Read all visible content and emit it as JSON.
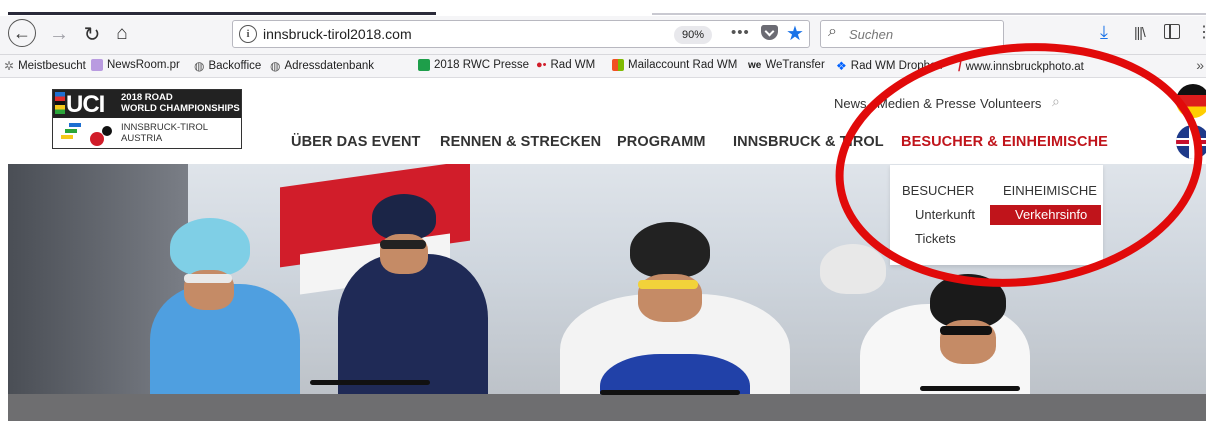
{
  "browser": {
    "url": "innsbruck-tirol2018.com",
    "zoom": "90%",
    "more_glyph": "•••",
    "search_placeholder": "Suchen",
    "bookmarks": [
      {
        "label": "Meistbesucht",
        "icon": "gear-star-icon",
        "color": "#777777"
      },
      {
        "label": "NewsRoom.pr",
        "icon": "newsroom-icon",
        "color": "#7d4cc7"
      },
      {
        "label": "Backoffice",
        "icon": "globe-icon",
        "color": "#555555"
      },
      {
        "label": "Adressdatenbank",
        "icon": "globe-icon",
        "color": "#555555"
      },
      {
        "label": "2018 RWC Presse",
        "icon": "sheet-icon",
        "color": "#1e9e4a"
      },
      {
        "label": "Rad WM",
        "icon": "bike-icon",
        "color": "#d11d2a"
      },
      {
        "label": "Mailaccount Rad WM",
        "icon": "windows-icon",
        "color": "#f25022"
      },
      {
        "label": "WeTransfer",
        "icon": "wetransfer-icon",
        "color": "#111111"
      },
      {
        "label": "Rad WM Dropbox",
        "icon": "dropbox-icon",
        "color": "#0061fe"
      },
      {
        "label": "www.innsbruckphoto.at",
        "icon": "slash-icon",
        "color": "#d11d2a"
      }
    ],
    "bookmarks_overflow": "»"
  },
  "logo": {
    "letters": "UCI",
    "line1": "2018 ROAD",
    "line2": "WORLD CHAMPIONSHIPS",
    "city1": "INNSBRUCK-TIROL",
    "city2": "AUSTRIA"
  },
  "topnav": {
    "news": "News",
    "media": "Medien & Presse",
    "volunteers": "Volunteers"
  },
  "mainnav": [
    {
      "label": "ÜBER DAS EVENT",
      "active": false
    },
    {
      "label": "RENNEN & STRECKEN",
      "active": false
    },
    {
      "label": "PROGRAMM",
      "active": false
    },
    {
      "label": "INNSBRUCK & TIROL",
      "active": false
    },
    {
      "label": "BESUCHER & EINHEIMISCHE",
      "active": true
    }
  ],
  "dropdown": {
    "col1_head": "BESUCHER",
    "col1_items": [
      "Unterkunft",
      "Tickets"
    ],
    "col2_head": "EINHEIMISCHE",
    "col2_items": [
      "Verkehrsinfo"
    ]
  },
  "colors": {
    "brand_red": "#c0141b",
    "annotation_red": "#e10a0a",
    "link_blue": "#1a73e8"
  }
}
